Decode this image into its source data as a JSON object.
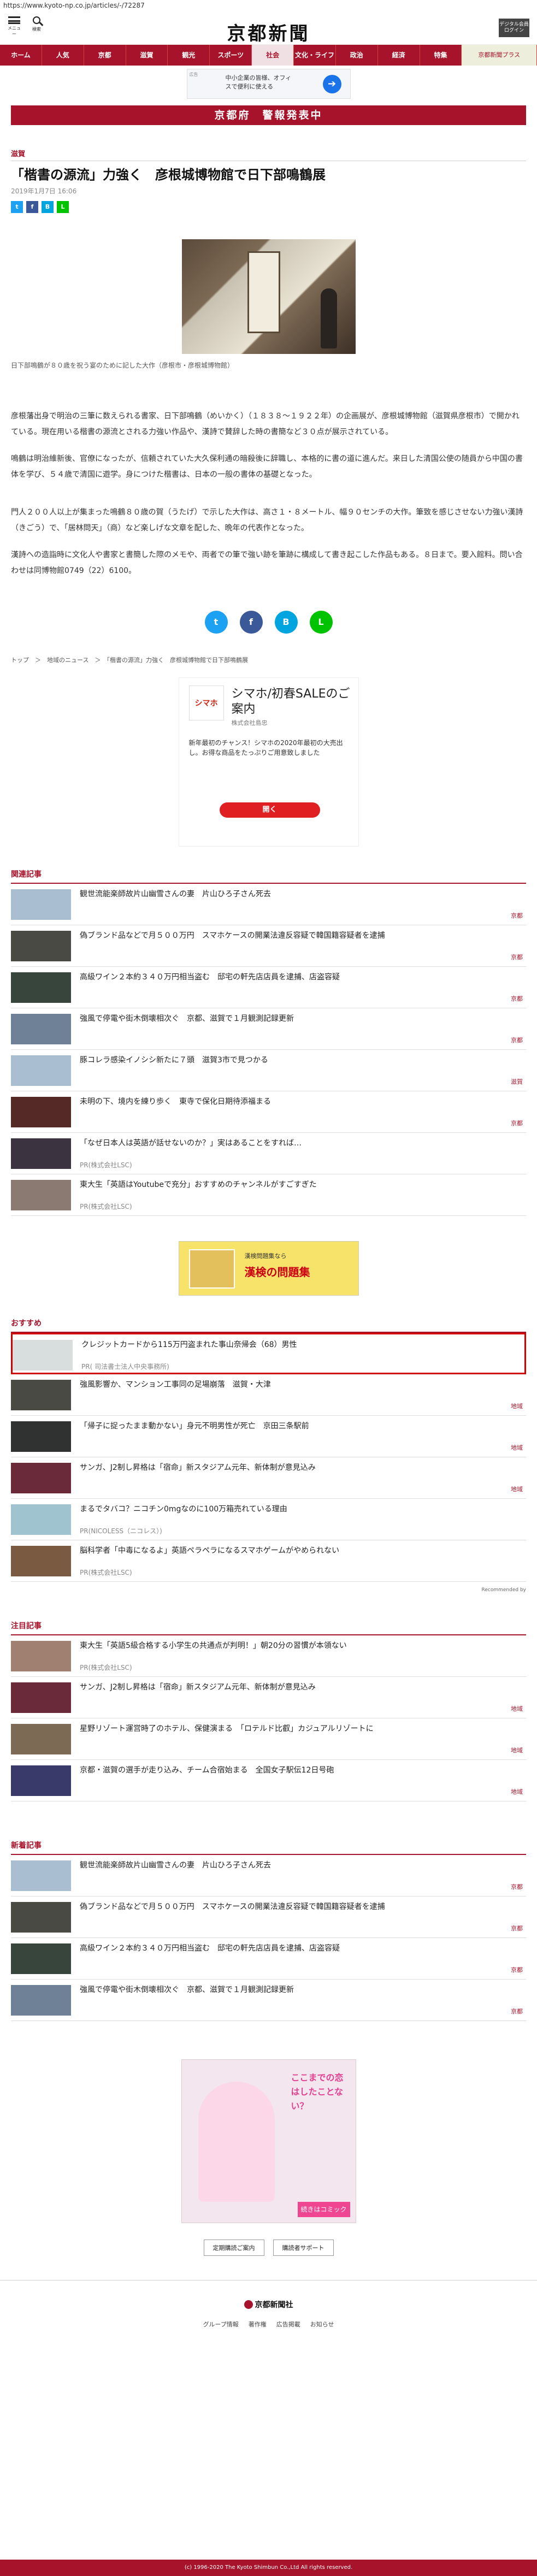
{
  "url": "https://www.kyoto-np.co.jp/articles/-/72287",
  "header": {
    "menu_label": "メニュー",
    "search_label": "検索",
    "logo": "京都新聞",
    "login": "デジタル会員 ログイン"
  },
  "nav": [
    "ホーム",
    "人気",
    "京都",
    "滋賀",
    "観光",
    "スポーツ",
    "社会",
    "文化・ライフ",
    "政治",
    "経済",
    "特集",
    "京都新聞プラス"
  ],
  "banner": {
    "ad_label": "広告",
    "text": "中小企業の皆様、オフィスで便利に使える"
  },
  "warning": "京都府　警報発表中",
  "article": {
    "category": "滋賀",
    "title": "「楷書の源流」力強く　彦根城博物館で日下部鳴鶴展",
    "date": "2019年1月7日 16:06",
    "caption": "日下部鳴鶴が８０歳を祝う宴のために記した大作（彦根市・彦根城博物館）",
    "paragraphs": [
      "彦根藩出身で明治の三筆に数えられる書家、日下部鳴鶴（めいかく）（１８３８～１９２２年）の企画展が、彦根城博物館（滋賀県彦根市）で開かれている。現在用いる楷書の源流とされる力強い作品や、漢詩で賛辞した時の書簡など３０点が展示されている。",
      "鳴鶴は明治維新後、官僚になったが、信頼されていた大久保利通の暗殺後に辞職し、本格的に書の道に進んだ。来日した清国公使の随員から中国の書体を学び、５４歳で清国に遊学。身につけた楷書は、日本の一般の書体の基礎となった。",
      "門人２００人以上が集まった鳴鶴８０歳の賀（うたげ）で示した大作は、高さ１・８メートル、幅９０センチの大作。筆致を感じさせない力強い漢詩（きごう）で、「居林問天」（商）など楽しげな文章を配した、晩年の代表作となった。",
      "漢詩への造詣時に文化人や書家と書簡した際のメモや、両者での筆で強い跡を筆跡に構成して書き起こした作品もある。８日まで。要入館料。問い合わせは同博物館0749（22）6100。"
    ]
  },
  "breadcrumb": "トップ　＞　地域のニュース　＞　「楷書の源流」力強く　彦根城博物館で日下部鳴鶴展",
  "ad": {
    "logo": "シマホ",
    "headline": "シマホ/初春SALEのご案内",
    "company": "株式会社島忠",
    "desc": "新年最初のチャンス！シマホの2020年最初の大売出し。お得な商品をたっぷりご用意致しました",
    "open": "開く"
  },
  "related": {
    "title": "関連記事",
    "items": [
      {
        "title": "観世流能楽師故片山幽雪さんの妻　片山ひろ子さん死去",
        "source": "京都"
      },
      {
        "title": "偽ブランド品などで月５００万円　スマホケースの開業法違反容疑で韓国籍容疑者を逮捕",
        "source": "京都"
      },
      {
        "title": "高級ワイン２本約３４０万円相当盗む　邸宅の軒先店店員を逮捕、店盗容疑",
        "source": "京都"
      },
      {
        "title": "強風で停電や街木倒壊相次ぐ　京都、滋賀で１月観測記録更新",
        "source": "京都"
      },
      {
        "title": "豚コレラ感染イノシシ新たに７頭　滋賀3市で見つかる",
        "source": "滋賀"
      },
      {
        "title": "未明の下、境内を練り歩く　東寺で保化日期待添福まる",
        "source": "京都"
      },
      {
        "title": "「なぜ日本人は英語が話せないのか？」実はあることをすれば…",
        "sub": "PR(株式会社LSC)"
      },
      {
        "title": "東大生「英語はYoutubeで充分」おすすめのチャンネルがすごすぎた",
        "sub": "PR(株式会社LSC)"
      }
    ]
  },
  "midad": {
    "line1": "漢検問題集なら",
    "line2": "漢検の問題集"
  },
  "recommend": {
    "title": "おすすめ",
    "items": [
      {
        "title": "クレジットカードから115万円盗まれた事山奈帰会（68）男性",
        "sub": "PR( 司法書士法人中央事務所)"
      },
      {
        "title": "強風影響か、マンション工事同の足場崩落　滋賀・大津",
        "source": "地域"
      },
      {
        "title": "「帰子に捉ったまま動かない」身元不明男性が死亡　京田三条駅前",
        "source": "地域"
      },
      {
        "title": "サンガ、J2制し昇格は「宿命」新スタジアム元年、新体制が意見込み",
        "source": "地域"
      },
      {
        "title": "まるでタバコ？ニコチン0mgなのに100万箱売れている理由",
        "sub": "PR(NICOLESS（ニコレス）)"
      },
      {
        "title": "脳科学者「中毒になるよ」英語ペラペラになるスマホゲームがやめられない",
        "sub": "PR(株式会社LSC)"
      }
    ],
    "powered": "Recommended by"
  },
  "attention": {
    "title": "注目記事",
    "items": [
      {
        "title": "東大生「英語5級合格する小学生の共通点が判明！」朝20分の習慣が本領ない",
        "sub": "PR(株式会社LSC)"
      },
      {
        "title": "サンガ、J2制し昇格は「宿命」新スタジアム元年、新体制が意見込み",
        "source": "地域"
      },
      {
        "title": "星野リゾート運営時了のホテル、保健演まる　「ロテルド比叡」カジュアルリゾートに",
        "source": "地域"
      },
      {
        "title": "京都・滋賀の選手が走り込み、チーム合宿始まる　全国女子駅伝12日号砲",
        "source": "地域"
      }
    ]
  },
  "newest": {
    "title": "新着記事",
    "items": [
      {
        "title": "観世流能楽師故片山幽雪さんの妻　片山ひろ子さん死去",
        "source": "京都"
      },
      {
        "title": "偽ブランド品などで月５００万円　スマホケースの開業法違反容疑で韓国籍容疑者を逮捕",
        "source": "京都"
      },
      {
        "title": "高級ワイン２本約３４０万円相当盗む　邸宅の軒先店店員を逮捕、店盗容疑",
        "source": "京都"
      },
      {
        "title": "強風で停電や街木倒壊相次ぐ　京都、滋賀で１月観測記録更新",
        "source": "京都"
      }
    ]
  },
  "bigad": {
    "text": "ここまでの恋はしたことない？",
    "button": "続きはコミック"
  },
  "foot_links": [
    "定期購読ご案内",
    "購読者サポート"
  ],
  "footer": {
    "logo": "京都新聞社",
    "links": [
      "グループ情報",
      "著作権",
      "広告掲載",
      "お知らせ"
    ],
    "copyright": "(c) 1996-2020 The Kyoto Shimbun Co.,Ltd All rights reserved."
  }
}
